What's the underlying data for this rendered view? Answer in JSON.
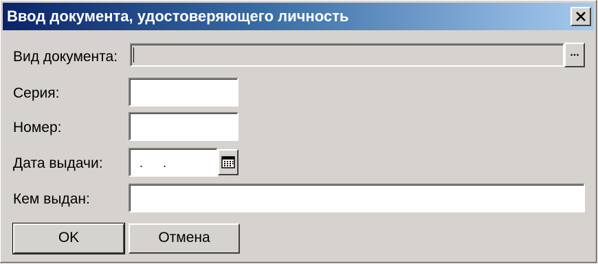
{
  "dialog": {
    "title": "Ввод документа, удостоверяющего личность",
    "close_icon": "close-icon"
  },
  "fields": {
    "doc_type": {
      "label": "Вид документа:",
      "value": "",
      "browse_label": "..."
    },
    "series": {
      "label": "Серия:",
      "value": ""
    },
    "number": {
      "label": "Номер:",
      "value": ""
    },
    "issue_date": {
      "label": "Дата выдачи:",
      "value": ". .",
      "calendar_icon": "calendar-icon"
    },
    "issued_by": {
      "label": "Кем выдан:",
      "value": ""
    }
  },
  "buttons": {
    "ok": "OK",
    "cancel": "Отмена"
  },
  "colors": {
    "title_gradient_start": "#0a246a",
    "title_gradient_end": "#a6caf0",
    "window_bg": "#d6d3ce"
  }
}
